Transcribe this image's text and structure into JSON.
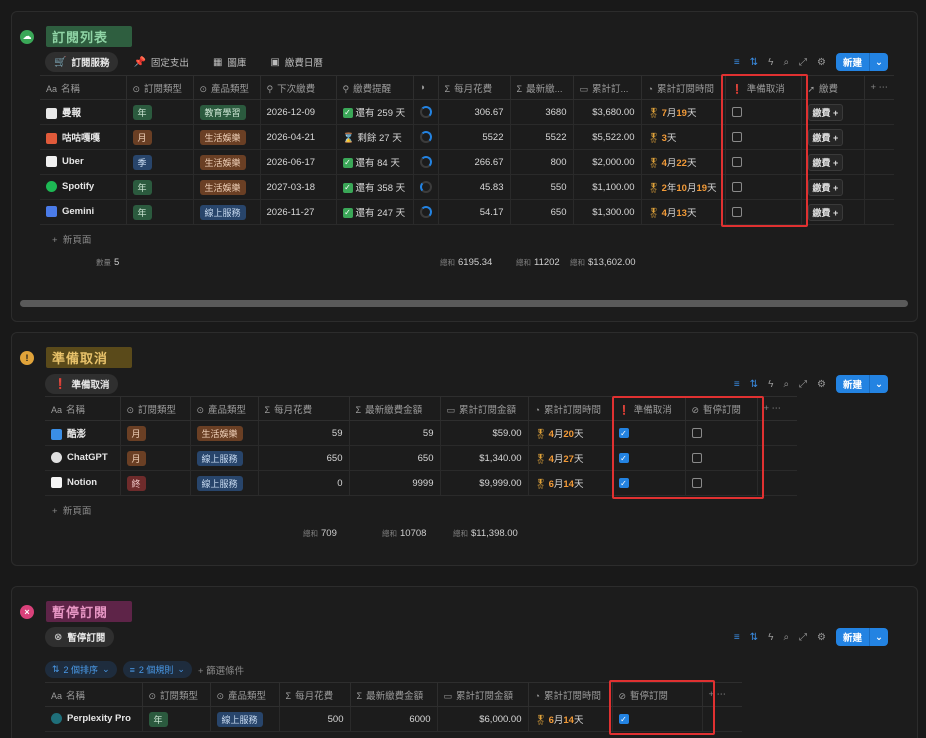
{
  "section1": {
    "title": "訂閱列表",
    "icon": "cloud-icon",
    "color": "#2e5e3f",
    "tabs": [
      "訂閱服務",
      "固定支出",
      "圖庫",
      "繳費日曆"
    ],
    "new_label": "新建",
    "columns": [
      "名稱",
      "訂閱類型",
      "產品類型",
      "下次繳費",
      "繳費提醒",
      "",
      "每月花費",
      "最新繳...",
      "累計訂...",
      "累計訂閱時間",
      "準備取消",
      "繳費"
    ],
    "rows": [
      {
        "name": "曼報",
        "type": "年",
        "category": "教育學習",
        "next": "2026-12-09",
        "reminder": "還有 259 天",
        "monthly": "306.67",
        "latest": "3680",
        "total": "$3,680.00",
        "dur_a": "7",
        "unit_a": "月",
        "dur_b": "19",
        "unit_b": "天",
        "pay": "繳費 +"
      },
      {
        "name": "咕咕嘎嘎",
        "type": "月",
        "category": "生活娛樂",
        "next": "2026-04-21",
        "reminder": "剩餘 27 天",
        "monthly": "5522",
        "latest": "5522",
        "total": "$5,522.00",
        "dur_a": "3",
        "unit_a": "天",
        "dur_b": "",
        "unit_b": "",
        "pay": "繳費 +"
      },
      {
        "name": "Uber",
        "type": "季",
        "category": "生活娛樂",
        "next": "2026-06-17",
        "reminder": "還有 84 天",
        "monthly": "266.67",
        "latest": "800",
        "total": "$2,000.00",
        "dur_a": "4",
        "unit_a": "月",
        "dur_b": "22",
        "unit_b": "天",
        "pay": "繳費 +"
      },
      {
        "name": "Spotify",
        "type": "年",
        "category": "生活娛樂",
        "next": "2027-03-18",
        "reminder": "還有 358 天",
        "monthly": "45.83",
        "latest": "550",
        "total": "$1,100.00",
        "dur_a": "2",
        "unit_a": "年",
        "dur_b": "10",
        "unit_b": "月",
        "dur_c": "19",
        "unit_c": "天",
        "pay": "繳費 +"
      },
      {
        "name": "Gemini",
        "type": "年",
        "category": "線上服務",
        "next": "2026-11-27",
        "reminder": "還有 247 天",
        "monthly": "54.17",
        "latest": "650",
        "total": "$1,300.00",
        "dur_a": "4",
        "unit_a": "月",
        "dur_b": "13",
        "unit_b": "天",
        "pay": "繳費 +"
      }
    ],
    "add_label": "新頁面",
    "count_label": "數量",
    "count": "5",
    "sum_label": "總和",
    "sum_monthly": "6195.34",
    "sum_latest": "11202",
    "sum_total": "$13,602.00"
  },
  "section2": {
    "title": "準備取消",
    "icon": "exclamation-icon",
    "color": "#5a4a1a",
    "tab": "準備取消",
    "new_label": "新建",
    "columns": [
      "名稱",
      "訂閱類型",
      "產品類型",
      "每月花費",
      "最新繳費金額",
      "累計訂閱金額",
      "累計訂閱時間",
      "準備取消",
      "暫停訂閱"
    ],
    "rows": [
      {
        "name": "酷澎",
        "type": "月",
        "category": "生活娛樂",
        "monthly": "59",
        "latest": "59",
        "total": "$59.00",
        "dur_a": "4",
        "unit_a": "月",
        "dur_b": "20",
        "unit_b": "天"
      },
      {
        "name": "ChatGPT",
        "type": "月",
        "category": "線上服務",
        "monthly": "650",
        "latest": "650",
        "total": "$1,340.00",
        "dur_a": "4",
        "unit_a": "月",
        "dur_b": "27",
        "unit_b": "天"
      },
      {
        "name": "Notion",
        "type": "終",
        "category": "線上服務",
        "monthly": "0",
        "latest": "9999",
        "total": "$9,999.00",
        "dur_a": "6",
        "unit_a": "月",
        "dur_b": "14",
        "unit_b": "天"
      }
    ],
    "add_label": "新頁面",
    "sum_label": "總和",
    "sum_monthly": "709",
    "sum_latest": "10708",
    "sum_total": "$11,398.00"
  },
  "section3": {
    "title": "暫停訂閱",
    "icon": "x-circle-icon",
    "color": "#5e2448",
    "tab": "暫停訂閱",
    "new_label": "新建",
    "sort_label": "2 個排序",
    "rule_label": "2 個規則",
    "filter_label": "篩選條件",
    "columns": [
      "名稱",
      "訂閱類型",
      "產品類型",
      "每月花費",
      "最新繳費金額",
      "累計訂閱金額",
      "累計訂閱時間",
      "暫停訂閱"
    ],
    "rows": [
      {
        "name": "Perplexity Pro",
        "type": "年",
        "category": "線上服務",
        "monthly": "500",
        "latest": "6000",
        "total": "$6,000.00",
        "dur_a": "6",
        "unit_a": "月",
        "dur_b": "14",
        "unit_b": "天"
      }
    ]
  }
}
